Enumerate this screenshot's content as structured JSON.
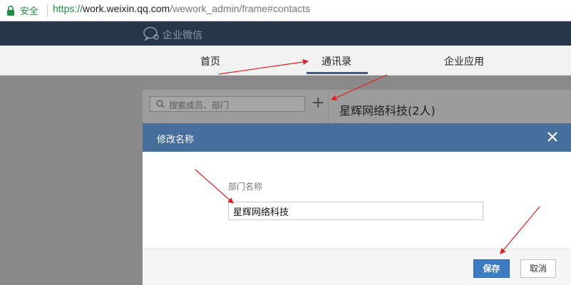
{
  "browser": {
    "secure_label": "安全",
    "url_scheme": "https://",
    "url_host": "work.weixin.qq.com",
    "url_path": "/wework_admin/frame#contacts"
  },
  "app": {
    "logo_text": "企业微信"
  },
  "nav": {
    "items": [
      {
        "label": "首页"
      },
      {
        "label": "通讯录",
        "active": true
      },
      {
        "label": "企业应用"
      }
    ]
  },
  "contacts": {
    "search_placeholder": "搜索成员、部门",
    "add_symbol": "+",
    "department_title": "星辉网络科技(2人)"
  },
  "modal": {
    "title": "修改名称",
    "field_label": "部门名称",
    "field_value": "星辉网络科技",
    "save_label": "保存",
    "cancel_label": "取消"
  },
  "colors": {
    "header_bg": "#26374c",
    "modal_header_bg": "#456e9b",
    "primary_button": "#3d7bc4",
    "annotation_arrow": "#e02020"
  }
}
